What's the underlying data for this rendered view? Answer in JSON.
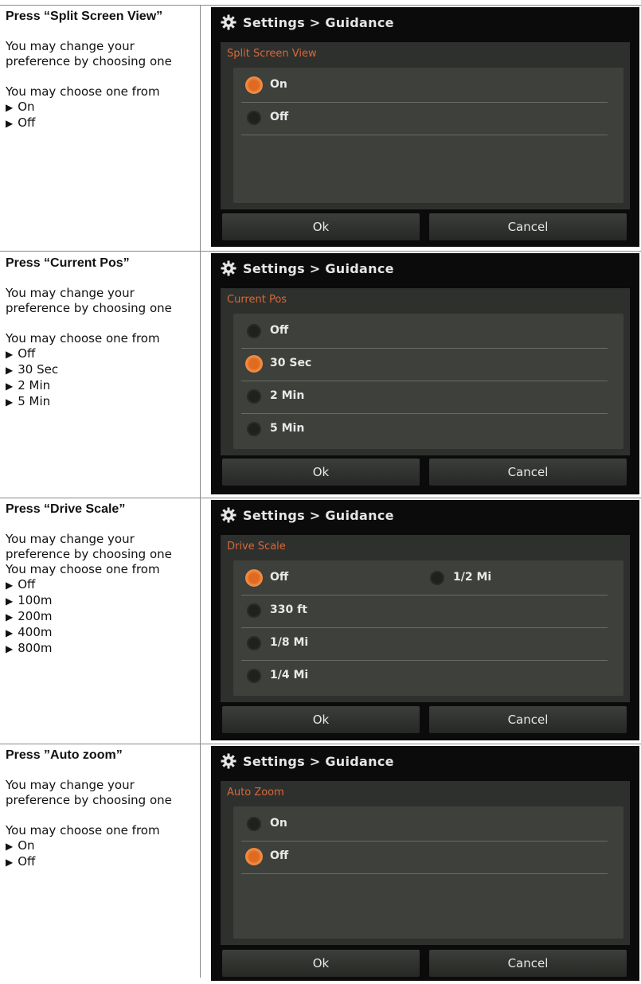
{
  "sections": [
    {
      "title": "Press “Split Screen View”",
      "desc1": "You may change your preference by choosing one",
      "desc2": "You may choose one from",
      "choices": [
        "On",
        "Off"
      ],
      "header": "Settings > Guidance",
      "section_label": "Split Screen View",
      "options": [
        {
          "label": "On",
          "selected": true
        },
        {
          "label": "Off",
          "selected": false
        }
      ],
      "ok_label": "Ok",
      "cancel_label": "Cancel"
    },
    {
      "title": "Press “Current Pos”",
      "desc1": "You may change your preference by choosing one",
      "desc2": "You may choose one from",
      "choices": [
        "Off",
        "30 Sec",
        "2 Min",
        "5 Min"
      ],
      "header": "Settings > Guidance",
      "section_label": "Current Pos",
      "options": [
        {
          "label": "Off",
          "selected": false
        },
        {
          "label": "30 Sec",
          "selected": true
        },
        {
          "label": "2 Min",
          "selected": false
        },
        {
          "label": "5 Min",
          "selected": false
        }
      ],
      "ok_label": "Ok",
      "cancel_label": "Cancel"
    },
    {
      "title": "Press “Drive Scale”",
      "desc1": "You may change your preference by choosing one",
      "desc2": "You may choose one from",
      "choices": [
        "Off",
        "100m",
        "200m",
        "400m",
        "800m"
      ],
      "header": "Settings > Guidance",
      "section_label": "Drive Scale",
      "options": [
        {
          "label": "Off",
          "selected": true
        },
        {
          "label": "330 ft",
          "selected": false
        },
        {
          "label": "1/8 Mi",
          "selected": false
        },
        {
          "label": "1/4 Mi",
          "selected": false
        },
        {
          "label": "1/2 Mi",
          "selected": false
        }
      ],
      "ok_label": "Ok",
      "cancel_label": "Cancel"
    },
    {
      "title": "Press ”Auto zoom”",
      "desc1": "You may change your preference by choosing one",
      "desc2": "You may choose one from",
      "choices": [
        "On",
        "Off"
      ],
      "header": "Settings > Guidance",
      "section_label": "Auto Zoom",
      "options": [
        {
          "label": "On",
          "selected": false
        },
        {
          "label": "Off",
          "selected": true
        }
      ],
      "ok_label": "Ok",
      "cancel_label": "Cancel"
    }
  ],
  "colors": {
    "panel_bg": "#0b0b0b",
    "body_bg": "#2e302d",
    "options_bg": "#3d403b",
    "accent_orange": "#e06a20",
    "section_label": "#d8683a"
  },
  "icons": [
    "gear-icon",
    "triangle-bullet-icon",
    "radio-icon"
  ]
}
